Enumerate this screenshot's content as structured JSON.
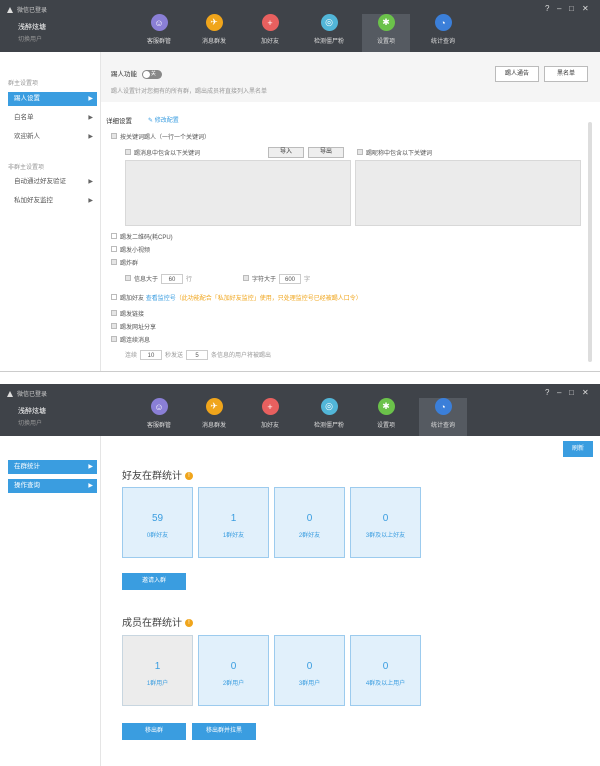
{
  "window": {
    "title": "微信已登录",
    "controls": [
      "?",
      "–",
      "□",
      "✕"
    ]
  },
  "account": {
    "name": "浅醉炫塘",
    "switch": "切换用户"
  },
  "nav": [
    {
      "label": "客服群管",
      "icon": "users-icon",
      "color": "#8a7fd6",
      "glyph": "☺"
    },
    {
      "label": "消息群发",
      "icon": "send-icon",
      "color": "#f0a51b",
      "glyph": "✈"
    },
    {
      "label": "加好友",
      "icon": "add-friend-icon",
      "color": "#e8605f",
      "glyph": "+"
    },
    {
      "label": "检测僵尸粉",
      "icon": "detect-icon",
      "color": "#52b6d8",
      "glyph": "◎"
    },
    {
      "label": "设置项",
      "icon": "settings-icon",
      "color": "#6bc24a",
      "glyph": "✱"
    },
    {
      "label": "统计查询",
      "icon": "stats-icon",
      "color": "#3b7fd9",
      "glyph": "◔"
    }
  ],
  "panel1": {
    "sidebar": {
      "group1": "群主设置项",
      "items1": [
        "踢人设置",
        "白名单",
        "欢迎新人"
      ],
      "group2": "非群主设置项",
      "items2": [
        "自动通过好友验证",
        "私加好友监控"
      ]
    },
    "kick": {
      "label": "踢人功能",
      "toggle": "关",
      "desc": "踢人设置针对您拥有的所有群，踢出成员将直接列入黑名单",
      "btn_notice": "踢人通告",
      "btn_blacklist": "黑名单"
    },
    "detail": {
      "title": "详细设置",
      "edit": "修改配置"
    },
    "keywords": {
      "label": "按关键词踢人（一行一个关键词）",
      "msg_label": "踢消息中包含以下关键词",
      "import": "导入",
      "export": "导出",
      "nick_label": "踢昵称中包含以下关键词"
    },
    "opts": {
      "qrcode": "踢发二维码(耗CPU)",
      "video": "踢发小视频",
      "flood": "踢炸群",
      "info_gt": "信息大于",
      "info_val": "60",
      "info_unit": "行",
      "char_gt": "字符大于",
      "char_val": "600",
      "char_unit": "字",
      "addfriend": "踢加好友",
      "view_monitor": "查看监控号",
      "warning": "（此功能配合「私加好友监控」使用，只处理监控号已经被踢人口令）",
      "link": "踢发链接",
      "share": "踢发网址分享",
      "msgs": "踢连续消息",
      "seq_label": "连续",
      "seq_val": "10",
      "seq_mid": "秒发送",
      "seq_val2": "5",
      "seq_tail": "条信息的用户将被踢出"
    }
  },
  "panel2": {
    "sidebar": [
      "在群统计",
      "操作查询"
    ],
    "refresh": "刷新",
    "friends": {
      "title": "好友在群统计",
      "cards": [
        {
          "num": "59",
          "label": "0群好友"
        },
        {
          "num": "1",
          "label": "1群好友"
        },
        {
          "num": "0",
          "label": "2群好友"
        },
        {
          "num": "0",
          "label": "3群及以上好友"
        }
      ],
      "btn": "邀请入群"
    },
    "members": {
      "title": "成员在群统计",
      "cards": [
        {
          "num": "1",
          "label": "1群用户"
        },
        {
          "num": "0",
          "label": "2群用户"
        },
        {
          "num": "0",
          "label": "3群用户"
        },
        {
          "num": "0",
          "label": "4群及以上用户"
        }
      ],
      "btn_remove": "移出群",
      "btn_remove_block": "移出群并拉黑"
    }
  }
}
